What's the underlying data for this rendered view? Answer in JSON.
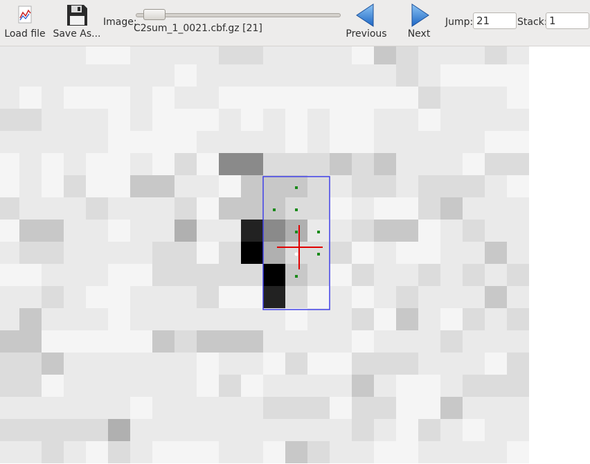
{
  "toolbar": {
    "load_label": "Load file",
    "save_label": "Save As...",
    "image_label": "Image:",
    "image_file": "C2sum_1_0021.cbf.gz [21]",
    "prev_label": "Previous",
    "next_label": "Next",
    "jump_label": "Jump:",
    "jump_value": "21",
    "stack_label": "Stack:",
    "stack_value": "1",
    "slider_position": 0.02,
    "icons": {
      "load": "chart-file-icon",
      "save": "floppy-disk-icon",
      "prev": "arrow-left-icon",
      "next": "arrow-right-icon"
    }
  },
  "viewer": {
    "pixel_grid": [
      "222211222233222214322232",
      "222222221222222222321111",
      "212111212211111111132221",
      "332221211121212112212222",
      "222221111222212112222211",
      "121211213166333434222133",
      "121311442214443233233321",
      "322232223144433121134222",
      "144221225228652234412322",
      "233222233139533312112242",
      "112221133333943132232323",
      "223211222311831212322242",
      "242221222222212231421323",
      "441111143444222212223222",
      "334222222122131133322213",
      "331222222131222242112333",
      "222222122222333133114222",
      "333335222222222232132122",
      "223213211122143221122221"
    ],
    "gray_levels": [
      "#ffffff",
      "#f5f5f5",
      "#eaeaea",
      "#dcdcdc",
      "#c8c8c8",
      "#b0b0b0",
      "#8a8a8a",
      "#555555",
      "#222222",
      "#000000"
    ],
    "colors": {
      "box": "#4040e8",
      "crosshair": "#e00000",
      "peak_dot": "#1a8a1a",
      "center_dot": "#ffffff"
    }
  }
}
